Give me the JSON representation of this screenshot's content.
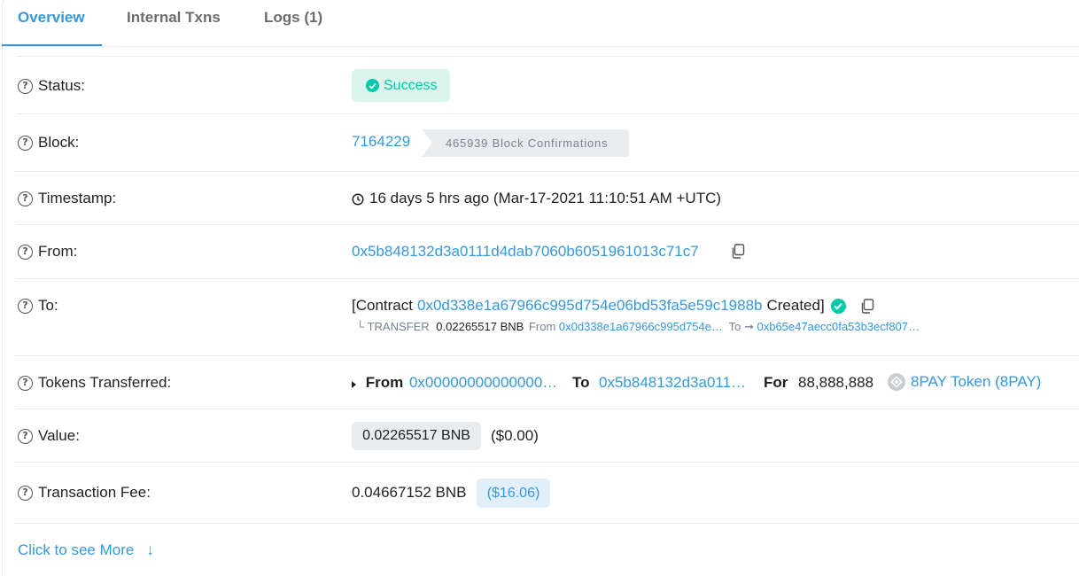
{
  "tabs": [
    {
      "label": "Overview"
    },
    {
      "label": "Internal Txns"
    },
    {
      "label": "Logs (1)"
    }
  ],
  "status": {
    "label": "Status:",
    "value": "Success"
  },
  "block": {
    "label": "Block:",
    "number": "7164229",
    "confirmations": "465939 Block Confirmations"
  },
  "timestamp": {
    "label": "Timestamp:",
    "value": "16 days 5 hrs ago (Mar-17-2021 11:10:51 AM +UTC)"
  },
  "from": {
    "label": "From:",
    "address": "0x5b848132d3a0111d4dab7060b6051961013c71c7"
  },
  "to": {
    "label": "To:",
    "prefix": "[Contract",
    "address": "0x0d338e1a67966c995d754e06bd53fa5e59c1988b",
    "suffix": "Created]",
    "transfer": {
      "type": "└ TRANSFER",
      "amount": "0.02265517 BNB",
      "from_label": "From",
      "from_address": "0x0d338e1a67966c995d754e…",
      "to_label": "To",
      "arrow": "➞",
      "to_address": "0xb65e47aecc0fa53b3ecf807…"
    }
  },
  "tokens": {
    "label": "Tokens Transferred:",
    "from_label": "From",
    "from_address": "0x00000000000000…",
    "to_label": "To",
    "to_address": "0x5b848132d3a011…",
    "for_label": "For",
    "amount": "88,888,888",
    "token_name": "8PAY Token (8PAY)"
  },
  "value": {
    "label": "Value:",
    "amount": "0.02265517 BNB",
    "usd": "($0.00)"
  },
  "fee": {
    "label": "Transaction Fee:",
    "amount": "0.04667152 BNB",
    "usd": "($16.06)"
  },
  "more": {
    "label": "Click to see More",
    "arrow": "↓"
  },
  "colors": {
    "link": "#3498db",
    "success": "#00c9a7",
    "border": "#e7eaf3"
  },
  "icons": [
    "help-icon",
    "check-circle-icon",
    "clock-icon",
    "copy-icon",
    "token-icon",
    "caret-right-icon",
    "arrow-down-icon"
  ]
}
